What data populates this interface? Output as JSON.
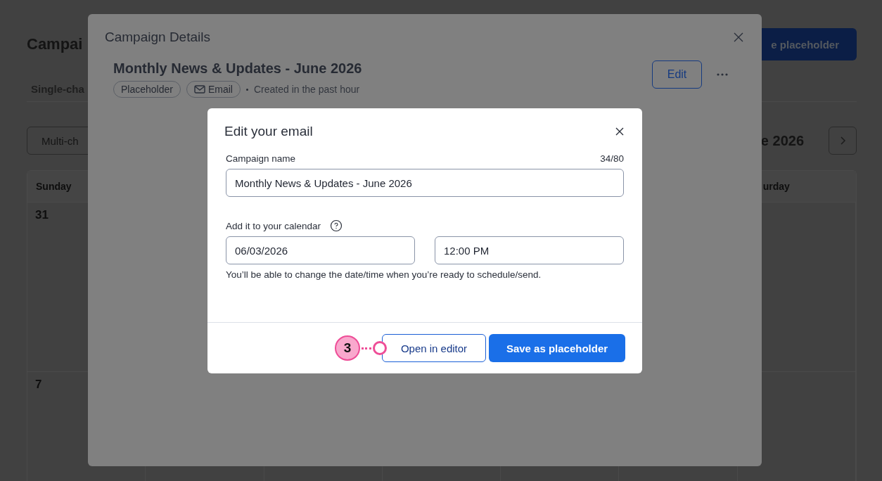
{
  "background": {
    "title": "Campai",
    "tab": "Single-cha",
    "view_button": "Multi-ch",
    "create_button": "e placeholder",
    "month": "e 2026",
    "weekday_headers": [
      "Sunday",
      "urday"
    ],
    "day_numbers": [
      "31",
      "7"
    ]
  },
  "campaign_details": {
    "title": "Campaign Details",
    "campaign_title": "Monthly News & Updates - June 2026",
    "tags": [
      {
        "label": "Placeholder",
        "kind": "status"
      },
      {
        "label": "Email",
        "kind": "channel"
      }
    ],
    "created": "Created in the past hour",
    "edit_button": "Edit"
  },
  "edit_dialog": {
    "title": "Edit your email",
    "name_label": "Campaign name",
    "name_counter": "34/80",
    "name_value": "Monthly News & Updates - June 2026",
    "calendar_label": "Add it to your calendar",
    "date_value": "06/03/2026",
    "time_value": "12:00 PM",
    "hint": "You’ll be able to change the date/time when you’re ready to schedule/send.",
    "buttons": [
      {
        "label": "Open in editor",
        "kind": "secondary"
      },
      {
        "label": "Save as placeholder",
        "kind": "primary"
      }
    ]
  },
  "annotation": {
    "label": "3"
  }
}
